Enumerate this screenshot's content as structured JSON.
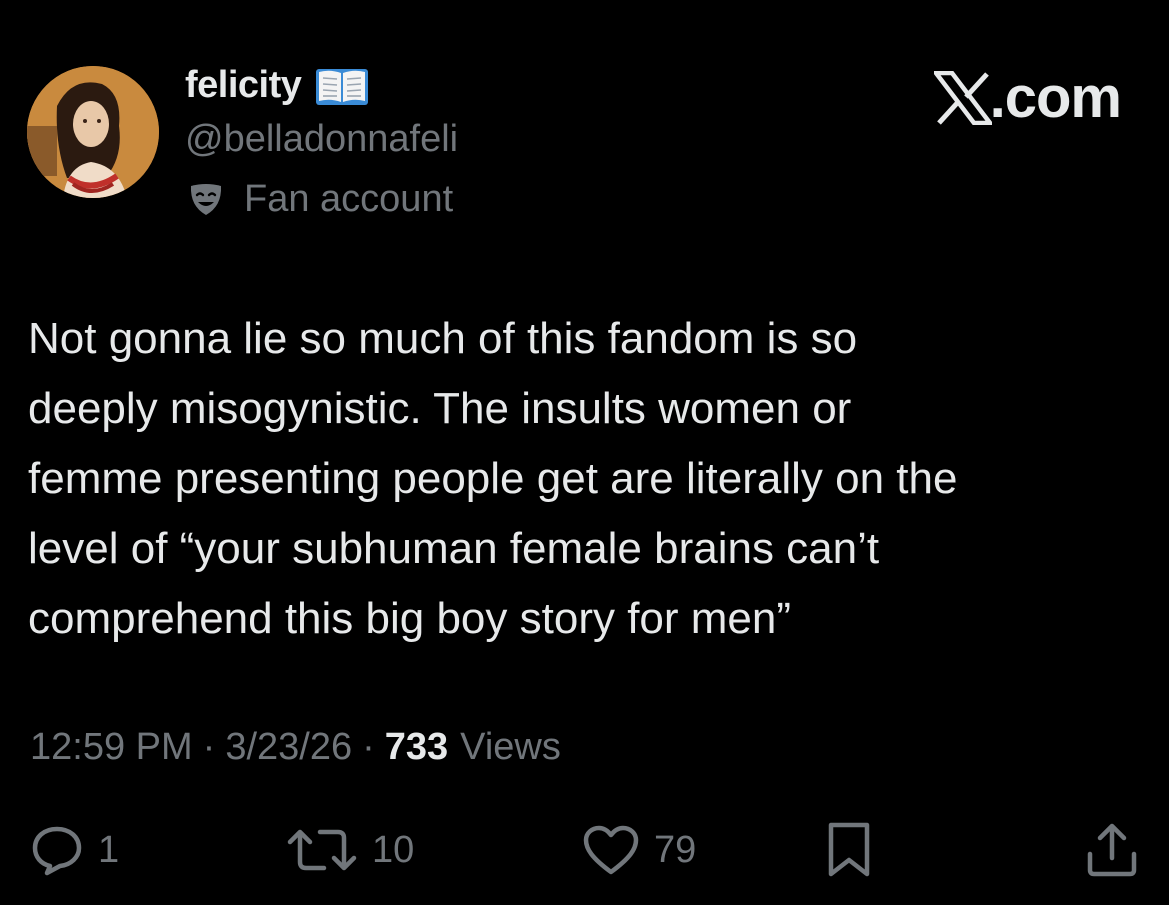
{
  "author": {
    "display_name": "felicity",
    "handle": "@belladonnafeli",
    "label": "Fan account",
    "name_icon": "open-book-emoji",
    "label_icon": "theater-mask-icon"
  },
  "brand": {
    "text": ".com",
    "logo": "x-logo"
  },
  "tweet": {
    "text": "Not gonna lie so much of this fandom is so\ndeeply misogynistic. The insults women or\nfemme presenting people get are literally on the\nlevel of “your subhuman female brains can’t\ncomprehend this big boy story for men”"
  },
  "meta": {
    "time": "12:59 PM",
    "separator": "·",
    "date": "3/23/26",
    "views_count": "733",
    "views_label": "Views"
  },
  "actions": {
    "reply_count": "1",
    "retweet_count": "10",
    "like_count": "79"
  },
  "colors": {
    "background": "#000000",
    "text_primary": "#e7e9ea",
    "text_secondary": "#71767b"
  }
}
